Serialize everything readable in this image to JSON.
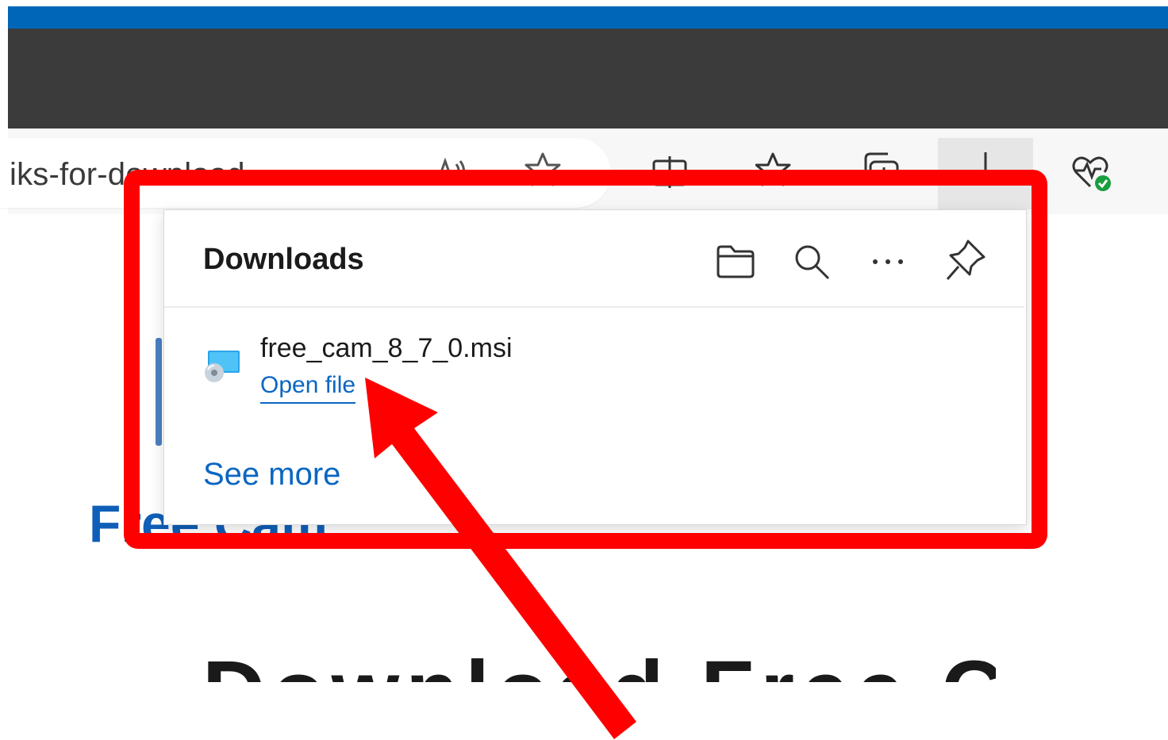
{
  "browser": {
    "address_text": "iks-for-download",
    "toolbar_icons": [
      "read-aloud-icon",
      "favorite-star-icon",
      "split-screen-icon",
      "favorites-icon",
      "collections-icon",
      "downloads-icon",
      "browser-essentials-icon"
    ]
  },
  "downloads_panel": {
    "title": "Downloads",
    "header_icons": [
      "folder-icon",
      "search-icon",
      "more-options-icon",
      "pin-icon"
    ],
    "items": [
      {
        "file_name": "free_cam_8_7_0.msi",
        "action_label": "Open file",
        "icon": "msi-installer-icon"
      }
    ],
    "see_more_label": "See more"
  },
  "page": {
    "heading_partial": "Free Cam",
    "heading_large_partial": "Download Free Cam"
  },
  "annotation": {
    "box_color": "#ff0000",
    "arrow_color": "#ff0000"
  }
}
